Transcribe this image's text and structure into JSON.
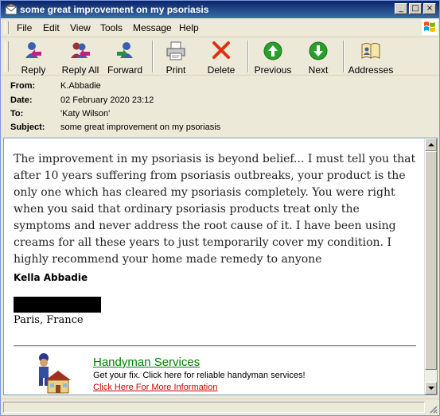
{
  "window": {
    "title": "some great improvement on my psoriasis"
  },
  "window_controls": {
    "minimize": "_",
    "maximize": "□",
    "close": "×"
  },
  "menu": [
    "File",
    "Edit",
    "View",
    "Tools",
    "Message",
    "Help"
  ],
  "toolbar": {
    "reply": "Reply",
    "reply_all": "Reply All",
    "forward": "Forward",
    "print": "Print",
    "delete": "Delete",
    "previous": "Previous",
    "next": "Next",
    "addresses": "Addresses"
  },
  "icons": {
    "reply": "reply-icon",
    "reply_all": "reply-all-icon",
    "forward": "forward-icon",
    "print": "printer-icon",
    "delete": "delete-x-icon",
    "previous": "up-arrow-icon",
    "next": "down-arrow-icon",
    "addresses": "address-book-icon"
  },
  "header": {
    "from_label": "From:",
    "from": "K.Abbadie",
    "date_label": "Date:",
    "date": "02 February 2020 23:12",
    "to_label": "To:",
    "to": "'Katy Wilson'",
    "subject_label": "Subject:",
    "subject": "some great improvement on my psoriasis"
  },
  "message": {
    "body": "The improvement in my psoriasis is beyond belief... I must tell you that after 10 years suffering from psoriasis outbreaks, your product is the only one which has cleared my psoriasis completely. You were right when you said that ordinary psoriasis products treat only the symptoms and never address the root cause of it. I have been using creams for all these years to just temporarily cover my condition. I highly recommend your home made remedy to anyone",
    "signature_name": "Kella Abbadie",
    "signature_location": "Paris, France"
  },
  "ad": {
    "title": "Handyman Services",
    "description": "Get your fix. Click here for reliable handyman services!",
    "link": "Click Here For More Information"
  },
  "colors": {
    "titlebar": "#0a246a",
    "ad_title": "#008000",
    "ad_link": "#cc0000",
    "delete_icon": "#e03010",
    "nav_green": "#2aa02a"
  }
}
